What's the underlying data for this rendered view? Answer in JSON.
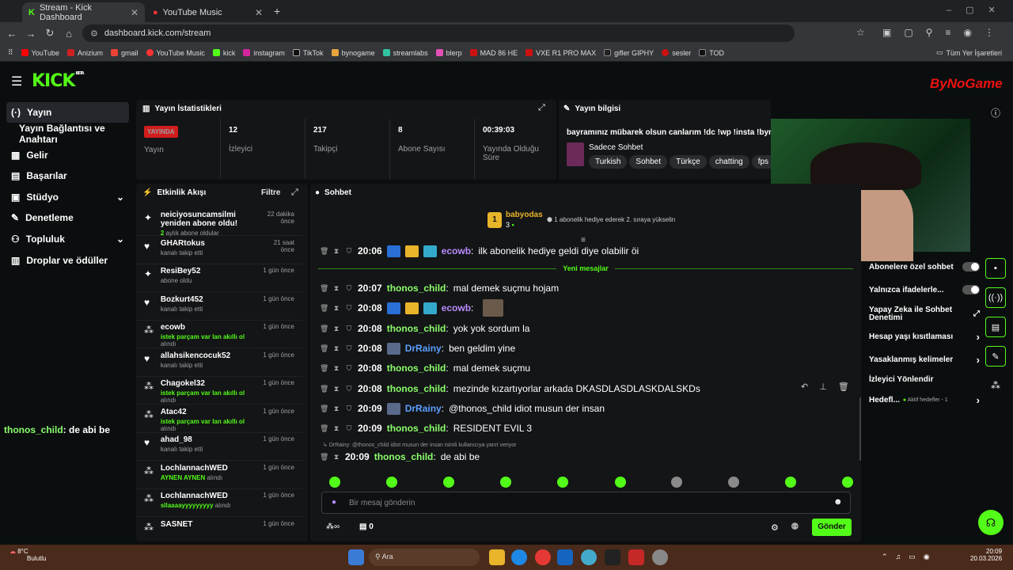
{
  "browser": {
    "tabs": [
      {
        "label": "Stream - Kick Dashboard"
      },
      {
        "label": "YouTube Music"
      }
    ],
    "url": "dashboard.kick.com/stream",
    "bookmarks": [
      "YouTube",
      "Anizium",
      "gmail",
      "YouTube Music",
      "kick",
      "instagram",
      "TikTok",
      "bynogame",
      "streamlabs",
      "blerp",
      "MAD 86 HE",
      "VXE R1 PRO MAX",
      "gifler GIPHY",
      "sesler",
      "TOD"
    ],
    "all_bookmarks": "Tüm Yer İşaretleri"
  },
  "logo": "KICK",
  "logo_beta": "BETA",
  "sidebar": [
    {
      "label": "Yayın",
      "icon": "(·)"
    },
    {
      "label": "Yayın Bağlantısı ve Anahtarı",
      "icon": ""
    },
    {
      "label": "Gelir",
      "icon": "▦"
    },
    {
      "label": "Başarılar",
      "icon": "▤"
    },
    {
      "label": "Stüdyo",
      "icon": "▣"
    },
    {
      "label": "Denetleme",
      "icon": "✎"
    },
    {
      "label": "Topluluk",
      "icon": "⚇"
    },
    {
      "label": "Droplar ve ödüller",
      "icon": "▥"
    }
  ],
  "overlay_chat": {
    "user": "thonos_child",
    "text": ": de abi be"
  },
  "stats": {
    "title": "Yayın İstatistikleri",
    "live": "YAYINDA",
    "live_label": "Yayın",
    "items": [
      {
        "value": "12",
        "label": "İzleyici"
      },
      {
        "value": "217",
        "label": "Takipçi"
      },
      {
        "value": "8",
        "label": "Abone Sayısı"
      },
      {
        "value": "00:39:03",
        "label": "Yayında Olduğu Süre"
      }
    ]
  },
  "info": {
    "title": "Yayın bilgisi",
    "stream_title": "bayramınız mübarek olsun canlarım !dc !wp !insta !bynog",
    "category": "Sadece Sohbet",
    "tags": [
      "Turkish",
      "Sohbet",
      "Türkçe",
      "chatting",
      "fps"
    ]
  },
  "activity": {
    "title": "Etkinlik Akışı",
    "filter": "Filtre",
    "items": [
      {
        "name": "neiciyosuncamsilmi yeniden abone oldu!",
        "sub_bold": "2",
        "sub": " aylık abone oldular",
        "time": "22 dakika önce",
        "icon": "✦"
      },
      {
        "name": "GHARtokus",
        "sub": "kanalı takip etti",
        "time": "21 saat önce",
        "icon": "♥"
      },
      {
        "name": "ResiBey52",
        "sub": "abone oldu",
        "time": "1 gün önce",
        "icon": "✦"
      },
      {
        "name": "Bozkurt452",
        "sub": "kanalı takip etti",
        "time": "1 gün önce",
        "icon": "♥"
      },
      {
        "name": "ecowb",
        "sub_bold": "istek parçam var lan akıllı ol",
        "sub": " alındı",
        "time": "1 gün önce",
        "icon": "⁂"
      },
      {
        "name": "allahsikencocuk52",
        "sub": "kanalı takip etti",
        "time": "1 gün önce",
        "icon": "♥"
      },
      {
        "name": "Chagokel32",
        "sub_bold": "istek parçam var lan akıllı ol",
        "sub": " alındı",
        "time": "1 gün önce",
        "icon": "⁂"
      },
      {
        "name": "Atac42",
        "sub_bold": "istek parçam var lan akıllı ol",
        "sub": " alındı",
        "time": "1 gün önce",
        "icon": "⁂"
      },
      {
        "name": "ahad_98",
        "sub": "kanalı takip etti",
        "time": "1 gün önce",
        "icon": "♥"
      },
      {
        "name": "LochlannachWED",
        "sub_bold": "AYNEN AYNEN",
        "sub": " alındı",
        "time": "1 gün önce",
        "icon": "⁂"
      },
      {
        "name": "LochlannachWED",
        "sub_bold": "sllaaaayyyyyyyyy",
        "sub": " alındı",
        "time": "1 gün önce",
        "icon": "⁂"
      },
      {
        "name": "SASNET",
        "sub": "",
        "time": "1 gün önce",
        "icon": "⁂"
      }
    ]
  },
  "chat": {
    "title": "Sohbet",
    "top_user": "babyodas",
    "top_count": "3",
    "gift_text": "1 abonelik hediye ederek 2. sıraya yükselin",
    "new_messages": "Yeni mesajlar",
    "messages": [
      {
        "time": "20:06",
        "user": "ecowb",
        "text": "ilk abonelik hediye geldi diye olabilir öi",
        "color": "#b98cff"
      },
      {
        "time": "20:07",
        "user": "thonos_child",
        "text": "mal demek suçmu hojam",
        "color": "#8bff6b"
      },
      {
        "time": "20:08",
        "user": "ecowb",
        "text": "",
        "color": "#b98cff"
      },
      {
        "time": "20:08",
        "user": "thonos_child",
        "text": "yok yok sordum la",
        "color": "#8bff6b"
      },
      {
        "time": "20:08",
        "user": "DrRainy",
        "text": "ben geldim yine",
        "color": "#5aa0ff"
      },
      {
        "time": "20:08",
        "user": "thonos_child",
        "text": "mal demek suçmu",
        "color": "#8bff6b"
      },
      {
        "time": "20:08",
        "user": "thonos_child",
        "text": "mezinde kızartıyorlar arkada DKASDLASDLASKDALSKDs",
        "color": "#8bff6b"
      },
      {
        "time": "20:09",
        "user": "DrRainy",
        "text": "@thonos_child idiot musun der insan",
        "color": "#5aa0ff"
      },
      {
        "time": "20:09",
        "user": "thonos_child",
        "text": "RESIDENT EVIL 3",
        "color": "#8bff6b"
      },
      {
        "time": "20:09",
        "user": "thonos_child",
        "text": "de abi be",
        "color": "#8bff6b"
      }
    ],
    "reply_note": "DrRainy: @thonos_child idiot musun der insan isimli kullanıcıya yanıt veriyor",
    "placeholder": "Bir mesaj gönderin",
    "points": "0",
    "send": "Gönder"
  },
  "settings": [
    {
      "label": "Abonelere özel sohbet"
    },
    {
      "label": "Yalnızca ifadelerle..."
    },
    {
      "label": "Yapay Zeka ile Sohbet Denetimi"
    },
    {
      "label": "Hesap yaşı kısıtlaması"
    },
    {
      "label": "Yasaklanmış kelimeler"
    },
    {
      "label": "İzleyici Yönlendir"
    },
    {
      "label": "Hedefl...",
      "extra": "Aktif hedefler - 1"
    }
  ],
  "webcam_logo": "ByNoGame",
  "taskbar": {
    "weather_temp": "8°C",
    "weather": "Bulutlu",
    "search": "Ara",
    "time": "20:09",
    "date": "20.03.2026"
  },
  "colors": {
    "accent": "#53fc18",
    "live": "#d11d1d"
  }
}
